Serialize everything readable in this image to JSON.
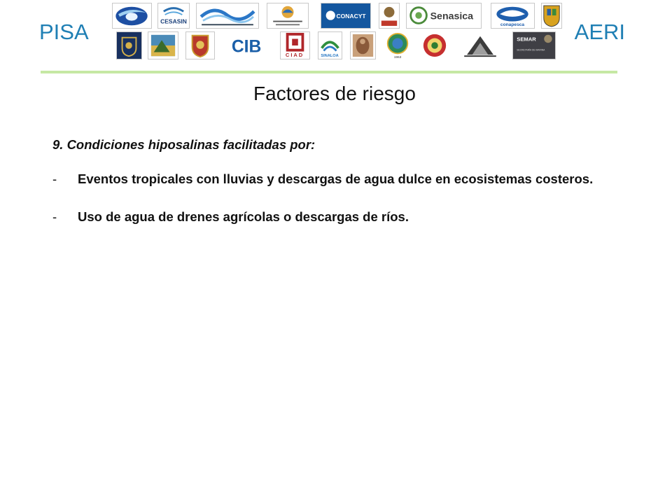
{
  "header": {
    "left_brand": "PISA",
    "right_brand": "AERI",
    "logos_row1": [
      {
        "name": "dolphin-globe-logo",
        "icon": "blue-globe-fish"
      },
      {
        "name": "cesasin-logo",
        "text": "CESASIN"
      },
      {
        "name": "comite-nayarit-logo",
        "icon": "blue-waves"
      },
      {
        "name": "comite-bcs-logo",
        "text": "Comité de Sanidad Acuícola de Baja California Sur A.C."
      },
      {
        "name": "conacyt-logo",
        "text": "CONACYT"
      },
      {
        "name": "sagarpa-logo",
        "text": "SAGARPA"
      },
      {
        "name": "senasica-logo",
        "text": "Senasica"
      },
      {
        "name": "conapesca-logo",
        "text": "conapesca"
      },
      {
        "name": "state-shield-logo",
        "icon": "shield"
      }
    ],
    "logos_row2": [
      {
        "name": "unam-logo",
        "icon": "crest"
      },
      {
        "name": "campeche-logo",
        "icon": "crest"
      },
      {
        "name": "state-crest-logo",
        "icon": "crest"
      },
      {
        "name": "cib-logo",
        "text": "CIB"
      },
      {
        "name": "ciad-logo",
        "text": "CIAD"
      },
      {
        "name": "sinaloa-logo",
        "text": "SINALOA"
      },
      {
        "name": "figure-logo",
        "icon": "figure"
      },
      {
        "name": "institute-1963-logo",
        "text": "1963"
      },
      {
        "name": "red-seal-logo",
        "icon": "seal"
      },
      {
        "name": "diagnostic-network-logo",
        "icon": "tree"
      },
      {
        "name": "semar-logo",
        "text": "SEMAR",
        "subtext": "SECRETARÍA DE MARINA"
      }
    ]
  },
  "title": "Factores de riesgo",
  "content": {
    "heading": "9. Condiciones hiposalinas facilitadas por:",
    "bullets": [
      {
        "dash": "-",
        "text": "Eventos tropicales con lluvias y descargas de agua dulce en ecosistemas costeros."
      },
      {
        "dash": "-",
        "text": "Uso de agua de drenes agrícolas o descargas de ríos."
      }
    ]
  },
  "colors": {
    "brand_text": "#1f7fb4",
    "divider": "#c6e8a4"
  }
}
